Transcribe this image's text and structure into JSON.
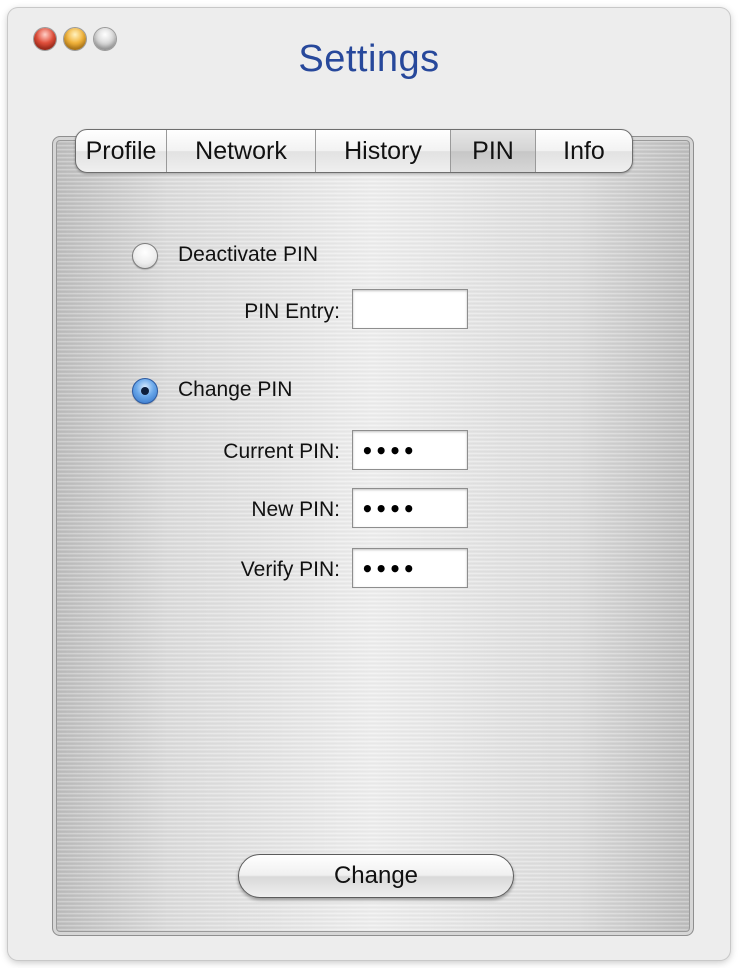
{
  "window": {
    "title": "Settings",
    "title_color": "#27489b",
    "controls": [
      "close-button",
      "minimize-button",
      "zoom-button"
    ]
  },
  "tabs": [
    {
      "label": "Profile",
      "selected": false
    },
    {
      "label": "Network",
      "selected": false
    },
    {
      "label": "History",
      "selected": false
    },
    {
      "label": "PIN",
      "selected": true
    },
    {
      "label": "Info",
      "selected": false
    }
  ],
  "pin_panel": {
    "deactivate": {
      "label": "Deactivate PIN",
      "selected": false,
      "pin_entry_label": "PIN Entry:",
      "pin_entry_value": ""
    },
    "change": {
      "label": "Change PIN",
      "selected": true,
      "current_pin_label": "Current PIN:",
      "current_pin_value": "••••",
      "new_pin_label": "New PIN:",
      "new_pin_value": "••••",
      "verify_pin_label": "Verify PIN:",
      "verify_pin_value": "••••"
    },
    "change_button_label": "Change"
  }
}
